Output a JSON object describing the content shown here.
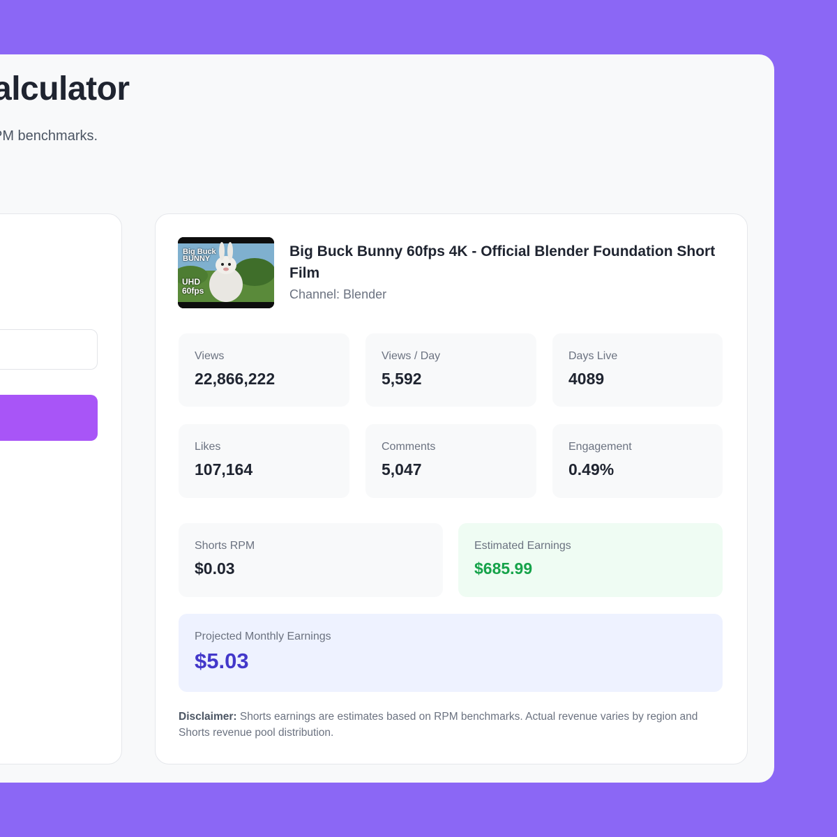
{
  "page": {
    "title": "alculator",
    "subtitle": "PM benchmarks."
  },
  "video": {
    "title": "Big Buck Bunny 60fps 4K - Official Blender Foundation Short Film",
    "channel": "Channel: Blender",
    "thumbnail": {
      "brand_line1": "Big Buck",
      "brand_line2": "BUNNY",
      "badge_line1": "UHD",
      "badge_line2": "60fps"
    }
  },
  "stats": {
    "views": {
      "label": "Views",
      "value": "22,866,222"
    },
    "views_per_day": {
      "label": "Views / Day",
      "value": "5,592"
    },
    "days_live": {
      "label": "Days Live",
      "value": "4089"
    },
    "likes": {
      "label": "Likes",
      "value": "107,164"
    },
    "comments": {
      "label": "Comments",
      "value": "5,047"
    },
    "engagement": {
      "label": "Engagement",
      "value": "0.49%"
    }
  },
  "earnings": {
    "shorts_rpm": {
      "label": "Shorts RPM",
      "value": "$0.03"
    },
    "estimated": {
      "label": "Estimated Earnings",
      "value": "$685.99"
    },
    "projected_monthly": {
      "label": "Projected Monthly Earnings",
      "value": "$5.03"
    }
  },
  "disclaimer": {
    "label": "Disclaimer:",
    "text": "Shorts earnings are estimates based on RPM benchmarks. Actual revenue varies by region and Shorts revenue pool distribution."
  },
  "colors": {
    "background": "#8b67f5",
    "button": "#a855f7",
    "earnings_green": "#16a34a",
    "monthly_indigo": "#4338ca"
  }
}
